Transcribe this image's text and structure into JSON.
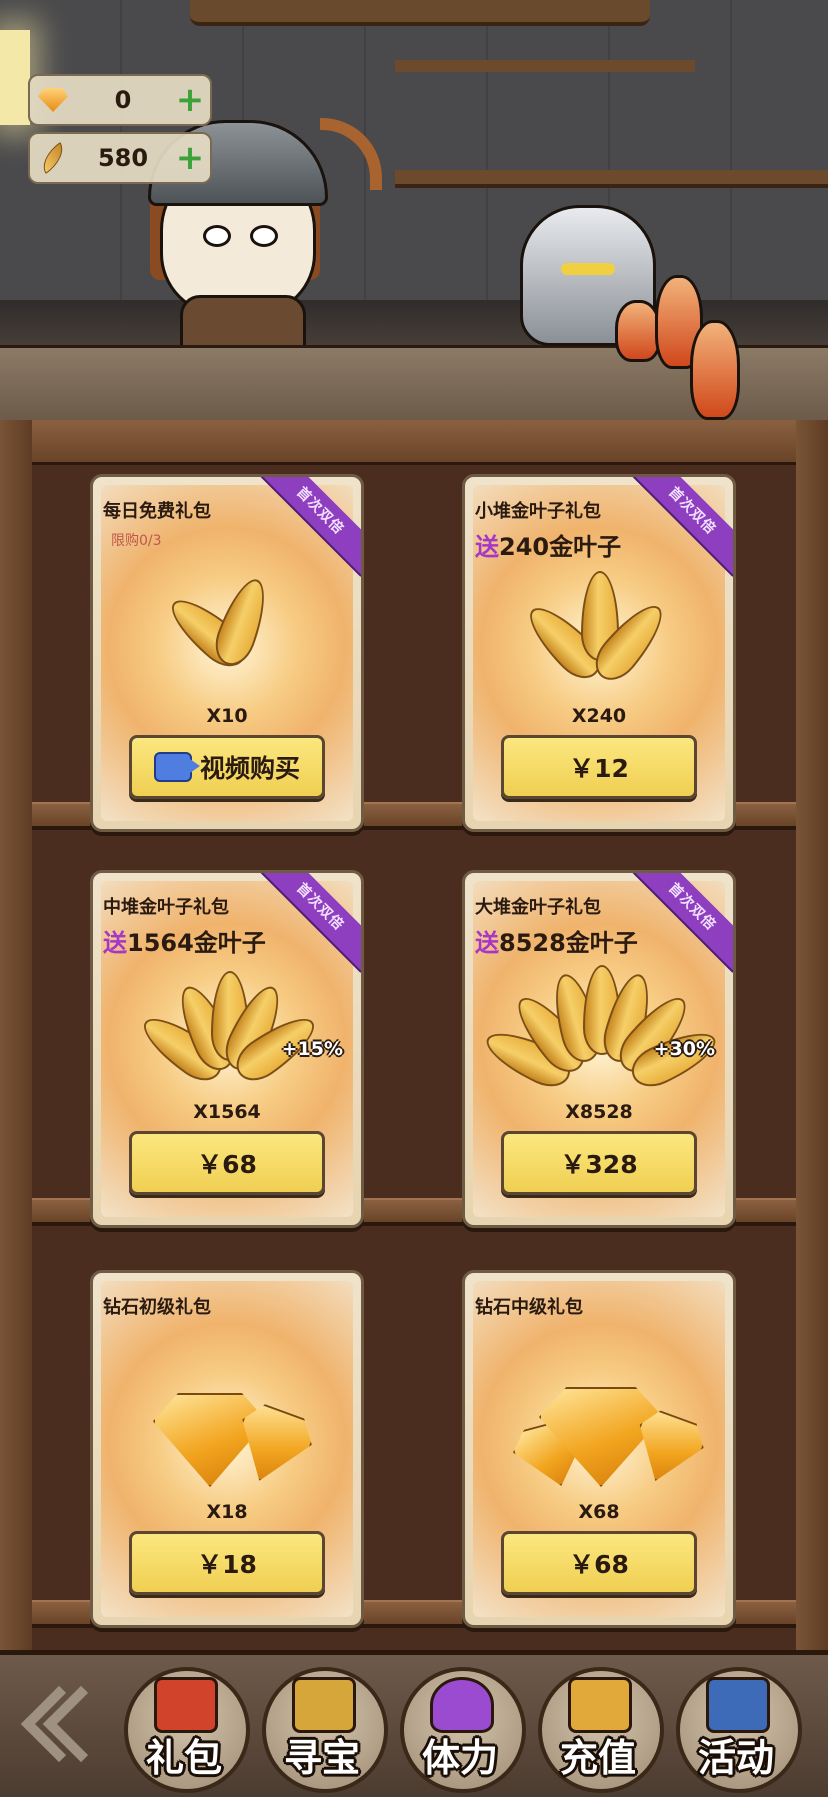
{
  "resources": {
    "diamond": {
      "icon": "diamond-icon",
      "value": "0"
    },
    "gold_leaf": {
      "icon": "gold-leaf-icon",
      "value": "580"
    }
  },
  "cards": [
    {
      "title": "每日免费礼包",
      "limit": "限购0/3",
      "ribbon": "首次双倍",
      "quantity": "X10",
      "button": "视频购买",
      "button_icon": "video-camera-icon",
      "item": "gold-leaf"
    },
    {
      "title": "小堆金叶子礼包",
      "bonus_prefix": "送",
      "bonus": "240金叶子",
      "ribbon": "首次双倍",
      "quantity": "X240",
      "button": "￥12",
      "item": "gold-leaf"
    },
    {
      "title": "中堆金叶子礼包",
      "bonus_prefix": "送",
      "bonus": "1564金叶子",
      "ribbon": "首次双倍",
      "quantity": "X1564",
      "extra": "+15%",
      "button": "￥68",
      "item": "gold-leaf"
    },
    {
      "title": "大堆金叶子礼包",
      "bonus_prefix": "送",
      "bonus": "8528金叶子",
      "ribbon": "首次双倍",
      "quantity": "X8528",
      "extra": "+30%",
      "button": "￥328",
      "item": "gold-leaf"
    },
    {
      "title": "钻石初级礼包",
      "quantity": "X18",
      "button": "￥18",
      "item": "diamond"
    },
    {
      "title": "钻石中级礼包",
      "quantity": "X68",
      "button": "￥68",
      "item": "diamond"
    }
  ],
  "nav": [
    {
      "label": "礼包",
      "icon": "gift-box-icon",
      "color": "#d2432c"
    },
    {
      "label": "寻宝",
      "icon": "treasure-map-icon",
      "color": "#d7a63a"
    },
    {
      "label": "体力",
      "icon": "potion-icon",
      "color": "#9b4bd0"
    },
    {
      "label": "充值",
      "icon": "gold-pile-icon",
      "color": "#e0a93a"
    },
    {
      "label": "活动",
      "icon": "horn-icon",
      "color": "#3d6bb8"
    }
  ],
  "colors": {
    "ribbon": "#8d3fc0",
    "button": "#f0cf52",
    "bonus_prefix": "#a636c8",
    "plus": "#3da23a"
  }
}
